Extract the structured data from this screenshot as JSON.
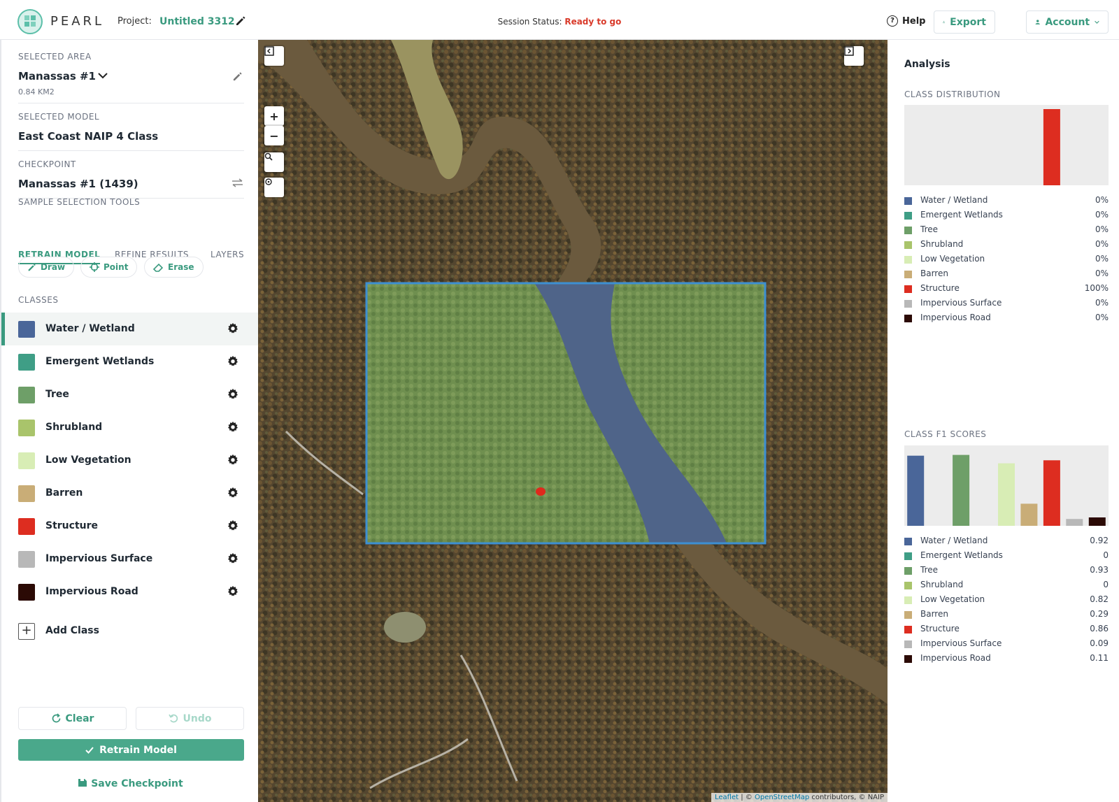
{
  "header": {
    "brand": "PEARL",
    "project_label": "Project:",
    "project_name": "Untitled 3312",
    "status_label": "Session Status:",
    "status_value": "Ready to go",
    "help": "Help",
    "export": "Export",
    "account": "Account"
  },
  "left": {
    "area_label": "SELECTED AREA",
    "area_name": "Manassas #1",
    "area_size": "0.84 KM2",
    "model_label": "SELECTED MODEL",
    "model_name": "East Coast NAIP 4 Class",
    "checkpoint_label": "CHECKPOINT",
    "checkpoint_name": "Manassas #1 (1439)",
    "tabs": [
      "RETRAIN MODEL",
      "REFINE RESULTS",
      "LAYERS"
    ],
    "tools_label": "SAMPLE SELECTION TOOLS",
    "tools": [
      "Draw",
      "Point",
      "Erase"
    ],
    "classes_label": "CLASSES",
    "add_class": "Add Class",
    "clear": "Clear",
    "undo": "Undo",
    "retrain": "Retrain Model",
    "save_checkpoint": "Save Checkpoint"
  },
  "classes": [
    {
      "name": "Water / Wetland",
      "color": "#4a6699"
    },
    {
      "name": "Emergent Wetlands",
      "color": "#3f9e86"
    },
    {
      "name": "Tree",
      "color": "#6e9f68"
    },
    {
      "name": "Shrubland",
      "color": "#a9c46b"
    },
    {
      "name": "Low Vegetation",
      "color": "#d8edb5"
    },
    {
      "name": "Barren",
      "color": "#c9ad77"
    },
    {
      "name": "Structure",
      "color": "#dd2d20"
    },
    {
      "name": "Impervious Surface",
      "color": "#b8b8b8"
    },
    {
      "name": "Impervious Road",
      "color": "#2b0a05"
    }
  ],
  "map": {
    "attribution_leaflet": "Leaflet",
    "attribution_osm": "OpenStreetMap",
    "attribution_rest": " contributors, © NAIP"
  },
  "analysis": {
    "title": "Analysis",
    "dist_label": "CLASS DISTRIBUTION",
    "f1_label": "CLASS F1 SCORES",
    "distribution": [
      "0%",
      "0%",
      "0%",
      "0%",
      "0%",
      "0%",
      "100%",
      "0%",
      "0%"
    ],
    "f1": [
      "0.92",
      "0",
      "0.93",
      "0",
      "0.82",
      "0.29",
      "0.86",
      "0.09",
      "0.11"
    ]
  },
  "chart_data": [
    {
      "type": "bar",
      "title": "CLASS DISTRIBUTION",
      "categories": [
        "Water / Wetland",
        "Emergent Wetlands",
        "Tree",
        "Shrubland",
        "Low Vegetation",
        "Barren",
        "Structure",
        "Impervious Surface",
        "Impervious Road"
      ],
      "values": [
        0,
        0,
        0,
        0,
        0,
        0,
        100,
        0,
        0
      ],
      "ylim": [
        0,
        100
      ]
    },
    {
      "type": "bar",
      "title": "CLASS F1 SCORES",
      "categories": [
        "Water / Wetland",
        "Emergent Wetlands",
        "Tree",
        "Shrubland",
        "Low Vegetation",
        "Barren",
        "Structure",
        "Impervious Surface",
        "Impervious Road"
      ],
      "values": [
        0.92,
        0,
        0.93,
        0,
        0.82,
        0.29,
        0.86,
        0.09,
        0.11
      ],
      "ylim": [
        0,
        1
      ]
    }
  ]
}
